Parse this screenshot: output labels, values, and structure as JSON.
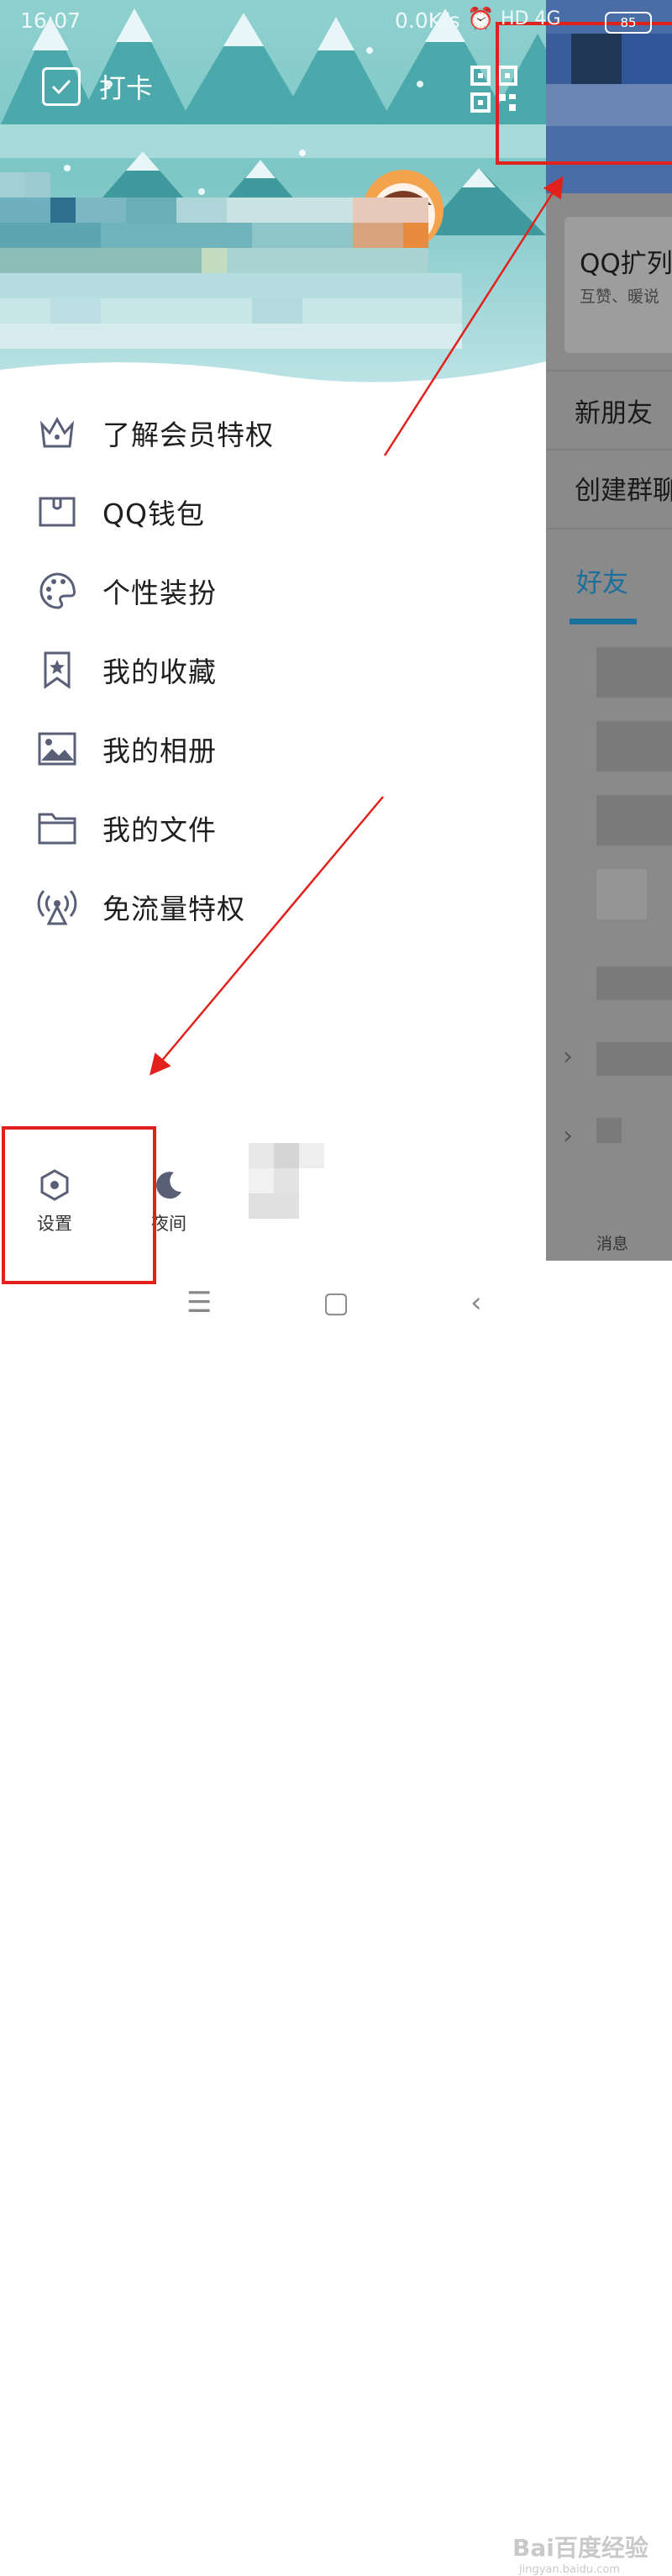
{
  "status_bar": {
    "time": "16:07",
    "network_speed": "0.0K/s",
    "signal": "HD 4G",
    "battery": "85"
  },
  "header": {
    "checkin_label": "打卡"
  },
  "menu": {
    "items": [
      {
        "label": "了解会员特权",
        "icon": "crown-icon"
      },
      {
        "label": "QQ钱包",
        "icon": "wallet-icon"
      },
      {
        "label": "个性装扮",
        "icon": "palette-icon"
      },
      {
        "label": "我的收藏",
        "icon": "bookmark-star-icon"
      },
      {
        "label": "我的相册",
        "icon": "photo-icon"
      },
      {
        "label": "我的文件",
        "icon": "folder-icon"
      },
      {
        "label": "免流量特权",
        "icon": "broadcast-icon"
      }
    ]
  },
  "bottom": {
    "settings_label": "设置",
    "night_label": "夜间"
  },
  "right_panel": {
    "card_title": "QQ扩列",
    "card_subtitle": "互赞、暖说",
    "new_friends": "新朋友",
    "create_group": "创建群聊",
    "tab_friends": "好友",
    "messages_label": "消息"
  },
  "watermark": {
    "text": "Bai百度经验",
    "sub": "jingyan.baidu.com"
  },
  "colors": {
    "accent": "#1b6f9b",
    "annotation": "#e2211c",
    "hero": "#7cc6c6"
  }
}
